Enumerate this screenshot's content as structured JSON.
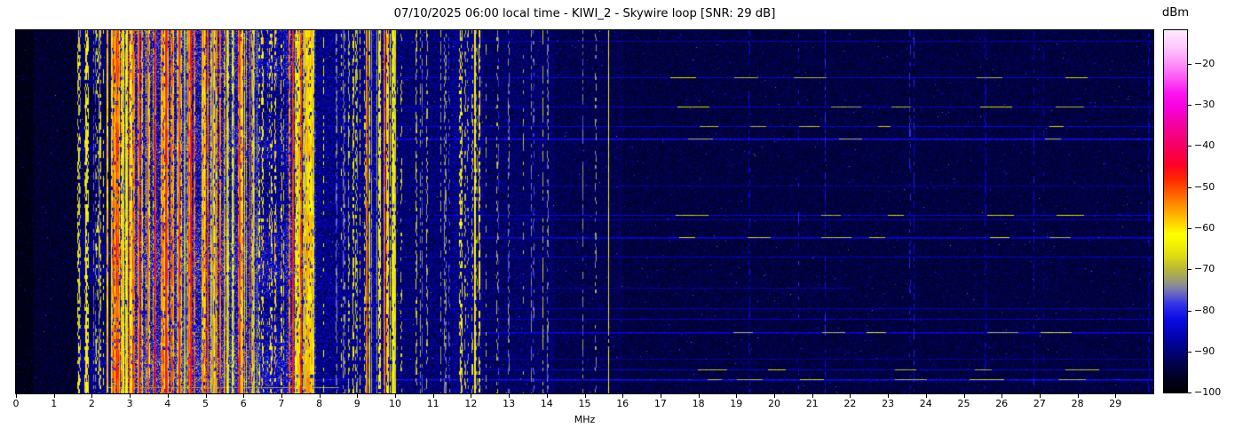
{
  "header": {
    "title": "07/10/2025 06:00 local time - KIWI_2 - Skywire loop [SNR: 29 dB]"
  },
  "chart_data": {
    "type": "heatmap",
    "title": "07/10/2025 06:00 local time - KIWI_2 - Skywire loop [SNR: 29 dB]",
    "xlabel": "MHz",
    "x_range": [
      0,
      30
    ],
    "x_ticks": [
      0,
      1,
      2,
      3,
      4,
      5,
      6,
      7,
      8,
      9,
      10,
      11,
      12,
      13,
      14,
      15,
      16,
      17,
      18,
      19,
      20,
      21,
      22,
      23,
      24,
      25,
      26,
      27,
      28,
      29
    ],
    "y_axis": "time (waterfall, no tick labels shown)",
    "seed": 20250710,
    "colorbar": {
      "label": "dBm",
      "range": [
        -100,
        -11.8
      ],
      "ticks": [
        -20,
        -30,
        -40,
        -50,
        -60,
        -70,
        -80,
        -90,
        -100
      ],
      "stops": [
        [
          -100,
          "#000000"
        ],
        [
          -96.5,
          "#010122"
        ],
        [
          -92,
          "#02025a"
        ],
        [
          -87,
          "#0202a8"
        ],
        [
          -82,
          "#0b0be6"
        ],
        [
          -78.5,
          "#3333e8"
        ],
        [
          -76,
          "#6565c2"
        ],
        [
          -74,
          "#8a8a96"
        ],
        [
          -72,
          "#a3a364"
        ],
        [
          -69.5,
          "#bcbc33"
        ],
        [
          -67,
          "#d9d914"
        ],
        [
          -64,
          "#f2f202"
        ],
        [
          -61.5,
          "#ffff00"
        ],
        [
          -58.5,
          "#ffcf00"
        ],
        [
          -55,
          "#ff9800"
        ],
        [
          -51.5,
          "#ff5f00"
        ],
        [
          -48,
          "#ff2600"
        ],
        [
          -44.5,
          "#fc0128"
        ],
        [
          -41,
          "#f80055"
        ],
        [
          -37.5,
          "#f50181"
        ],
        [
          -34,
          "#f401ad"
        ],
        [
          -30.5,
          "#f801dd"
        ],
        [
          -27,
          "#fb16f1"
        ],
        [
          -23.5,
          "#fc56f5"
        ],
        [
          -20,
          "#fd90f9"
        ],
        [
          -16,
          "#fec7fc"
        ],
        [
          -11.8,
          "#ffeafe"
        ]
      ]
    },
    "noise_bands": [
      {
        "f0": 0.0,
        "f1": 0.45,
        "mean": -97.5,
        "std": 1.8,
        "busy": false
      },
      {
        "f0": 0.45,
        "f1": 1.6,
        "mean": -95.5,
        "std": 2.2,
        "busy": false
      },
      {
        "f0": 1.6,
        "f1": 2.5,
        "mean": -90.5,
        "std": 4.0,
        "busy": true
      },
      {
        "f0": 2.5,
        "f1": 5.2,
        "mean": -82.0,
        "std": 6.5,
        "busy": true
      },
      {
        "f0": 5.2,
        "f1": 6.4,
        "mean": -83.0,
        "std": 6.5,
        "busy": true
      },
      {
        "f0": 6.4,
        "f1": 7.1,
        "mean": -86.0,
        "std": 5.5,
        "busy": true
      },
      {
        "f0": 7.1,
        "f1": 7.9,
        "mean": -83.5,
        "std": 6.5,
        "busy": true
      },
      {
        "f0": 7.9,
        "f1": 9.3,
        "mean": -89.0,
        "std": 4.5,
        "busy": false
      },
      {
        "f0": 9.3,
        "f1": 10.0,
        "mean": -87.0,
        "std": 5.0,
        "busy": false
      },
      {
        "f0": 10.0,
        "f1": 11.5,
        "mean": -90.5,
        "std": 3.5,
        "busy": false
      },
      {
        "f0": 11.5,
        "f1": 12.3,
        "mean": -89.0,
        "std": 4.2,
        "busy": false
      },
      {
        "f0": 12.3,
        "f1": 14.2,
        "mean": -91.5,
        "std": 3.0,
        "busy": false
      },
      {
        "f0": 14.2,
        "f1": 16.0,
        "mean": -93.0,
        "std": 2.6,
        "busy": false
      },
      {
        "f0": 16.0,
        "f1": 30.0,
        "mean": -94.0,
        "std": 2.3,
        "busy": false
      }
    ],
    "signal_bands": [
      {
        "f0": 1.6,
        "f1": 2.5,
        "count": 12,
        "lmin": -76,
        "lmax": -60,
        "dash": true
      },
      {
        "f0": 2.5,
        "f1": 5.2,
        "count": 80,
        "lmin": -74,
        "lmax": -50,
        "dash": false
      },
      {
        "f0": 5.2,
        "f1": 6.4,
        "count": 32,
        "lmin": -74,
        "lmax": -52,
        "dash": false
      },
      {
        "f0": 6.4,
        "f1": 7.1,
        "count": 14,
        "lmin": -76,
        "lmax": -58,
        "dash": true
      },
      {
        "f0": 7.1,
        "f1": 7.9,
        "count": 26,
        "lmin": -73,
        "lmax": -52,
        "dash": false
      },
      {
        "f0": 7.9,
        "f1": 9.3,
        "count": 14,
        "lmin": -78,
        "lmax": -62,
        "dash": true
      },
      {
        "f0": 9.3,
        "f1": 10.0,
        "count": 16,
        "lmin": -73,
        "lmax": -58,
        "dash": false
      },
      {
        "f0": 10.0,
        "f1": 11.5,
        "count": 9,
        "lmin": -79,
        "lmax": -67,
        "dash": true
      },
      {
        "f0": 11.5,
        "f1": 12.3,
        "count": 10,
        "lmin": -75,
        "lmax": -60,
        "dash": true
      },
      {
        "f0": 12.3,
        "f1": 14.2,
        "count": 7,
        "lmin": -79,
        "lmax": -69,
        "dash": true
      },
      {
        "f0": 14.2,
        "f1": 16.0,
        "count": 3,
        "lmin": -81,
        "lmax": -72,
        "dash": true
      },
      {
        "f0": 16.0,
        "f1": 30.0,
        "count": 10,
        "lmin": -87,
        "lmax": -79,
        "dash": true
      }
    ],
    "carriers": [
      {
        "f": 2.65,
        "level": -50,
        "w": 2,
        "duty": 0.97
      },
      {
        "f": 3.25,
        "level": -47,
        "w": 2,
        "duty": 0.97
      },
      {
        "f": 3.68,
        "level": -48,
        "w": 2,
        "duty": 0.97
      },
      {
        "f": 3.96,
        "level": -46,
        "w": 2,
        "duty": 0.97
      },
      {
        "f": 4.31,
        "level": -48,
        "w": 2,
        "duty": 0.97
      },
      {
        "f": 4.61,
        "level": -47,
        "w": 2,
        "duty": 0.97
      },
      {
        "f": 5.06,
        "level": -50,
        "w": 2,
        "duty": 0.95
      },
      {
        "f": 5.9,
        "level": -49,
        "w": 2,
        "duty": 0.95
      },
      {
        "f": 6.17,
        "level": -52,
        "w": 1,
        "duty": 0.9
      },
      {
        "f": 7.3,
        "level": -48,
        "w": 2,
        "duty": 0.97
      },
      {
        "f": 7.52,
        "level": -50,
        "w": 2,
        "duty": 0.95
      },
      {
        "f": 9.25,
        "level": -53,
        "w": 2,
        "duty": 0.95
      },
      {
        "f": 9.72,
        "level": -52,
        "w": 2,
        "duty": 0.95
      },
      {
        "f": 1.84,
        "level": -63,
        "w": 2,
        "duty": 0.9
      },
      {
        "f": 2.42,
        "level": -58,
        "w": 2,
        "duty": 0.95
      },
      {
        "f": 7.8,
        "level": -58,
        "w": 2,
        "duty": 0.95
      },
      {
        "f": 12.11,
        "level": -62,
        "w": 2,
        "duty": 0.97
      },
      {
        "f": 15.64,
        "level": -64,
        "w": 1,
        "duty": 0.97
      },
      {
        "f": 2.2,
        "level": -72,
        "w": 2,
        "duty": 0.7
      },
      {
        "f": 9.0,
        "level": -73,
        "w": 2,
        "duty": 0.6
      },
      {
        "f": 11.3,
        "level": -74,
        "w": 2,
        "duty": 0.5
      },
      {
        "f": 13.0,
        "level": -75,
        "w": 2,
        "duty": 0.5
      },
      {
        "f": 14.03,
        "level": -74,
        "w": 2,
        "duty": 0.5
      }
    ],
    "time_events": [
      {
        "t": 0.029,
        "f0": 7,
        "f1": 30,
        "level": -87.0,
        "hot": false
      },
      {
        "t": 0.13,
        "f0": 8,
        "f1": 30,
        "level": -84.0,
        "hot": true
      },
      {
        "t": 0.21,
        "f0": 10,
        "f1": 30,
        "level": -85.0,
        "hot": true
      },
      {
        "t": 0.264,
        "f0": 8,
        "f1": 30,
        "level": -84.5,
        "hot": true
      },
      {
        "t": 0.298,
        "f0": 10,
        "f1": 30,
        "level": -82.0,
        "hot": true
      },
      {
        "t": 0.43,
        "f0": 8,
        "f1": 30,
        "level": -88.0,
        "hot": false
      },
      {
        "t": 0.509,
        "f0": 11,
        "f1": 30,
        "level": -84.0,
        "hot": true
      },
      {
        "t": 0.523,
        "f0": 9,
        "f1": 30,
        "level": -86.5,
        "hot": false
      },
      {
        "t": 0.572,
        "f0": 12,
        "f1": 30,
        "level": -83.5,
        "hot": true
      },
      {
        "t": 0.626,
        "f0": 9,
        "f1": 30,
        "level": -85.5,
        "hot": false
      },
      {
        "t": 0.712,
        "f0": 5,
        "f1": 22,
        "level": -87.5,
        "hot": false
      },
      {
        "t": 0.768,
        "f0": 9,
        "f1": 30,
        "level": -86.5,
        "hot": false
      },
      {
        "t": 0.797,
        "f0": 10,
        "f1": 30,
        "level": -85.5,
        "hot": false
      },
      {
        "t": 0.834,
        "f0": 12,
        "f1": 30,
        "level": -83.5,
        "hot": true
      },
      {
        "t": 0.907,
        "f0": 10,
        "f1": 30,
        "level": -88.0,
        "hot": false
      },
      {
        "t": 0.936,
        "f0": 12,
        "f1": 30,
        "level": -84.5,
        "hot": true
      },
      {
        "t": 0.963,
        "f0": 5,
        "f1": 30,
        "level": -82.0,
        "hot": true
      },
      {
        "t": 0.985,
        "f0": 2.4,
        "f1": 8.5,
        "level": -72.0,
        "hot": false
      }
    ],
    "event_hot_spots": [
      17.9,
      19.6,
      21.45,
      23.2,
      25.45,
      27.9
    ]
  }
}
